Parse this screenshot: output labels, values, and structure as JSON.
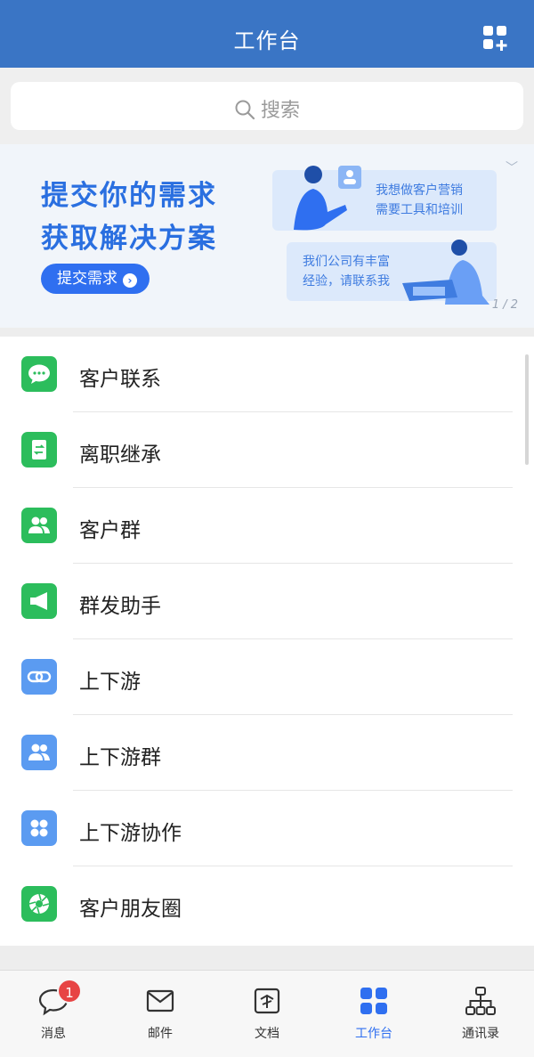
{
  "header": {
    "title": "工作台",
    "add_icon": "grid-plus-icon"
  },
  "search": {
    "placeholder": "搜索",
    "icon": "search-icon"
  },
  "banner": {
    "line1": "提交你的需求",
    "line2": "获取解决方案",
    "button": "提交需求",
    "card1": "我想做客户营销\n需要工具和培训",
    "card2": "我们公司有丰富\n经验，请联系我",
    "pager": "1 / 2"
  },
  "apps": [
    {
      "label": "客户联系",
      "icon": "chat-bubble-icon",
      "color": "#2cbd5c"
    },
    {
      "label": "离职继承",
      "icon": "transfer-doc-icon",
      "color": "#2cbd5c"
    },
    {
      "label": "客户群",
      "icon": "group-icon",
      "color": "#2cbd5c"
    },
    {
      "label": "群发助手",
      "icon": "megaphone-icon",
      "color": "#2cbd5c"
    },
    {
      "label": "上下游",
      "icon": "link-icon",
      "color": "#5b9bf1"
    },
    {
      "label": "上下游群",
      "icon": "group-icon",
      "color": "#5b9bf1"
    },
    {
      "label": "上下游协作",
      "icon": "apps-icon",
      "color": "#5b9bf1"
    },
    {
      "label": "客户朋友圈",
      "icon": "aperture-icon",
      "color": "#2cbd5c"
    }
  ],
  "tabs": [
    {
      "label": "消息",
      "icon": "chat-icon",
      "badge": "1"
    },
    {
      "label": "邮件",
      "icon": "mail-icon"
    },
    {
      "label": "文档",
      "icon": "document-icon"
    },
    {
      "label": "工作台",
      "icon": "workbench-icon",
      "active": true
    },
    {
      "label": "通讯录",
      "icon": "org-chart-icon"
    }
  ],
  "colors": {
    "primary": "#3a75c5",
    "accent": "#2f6ff0",
    "green": "#2cbd5c",
    "blue": "#5b9bf1",
    "badge": "#e74444"
  }
}
